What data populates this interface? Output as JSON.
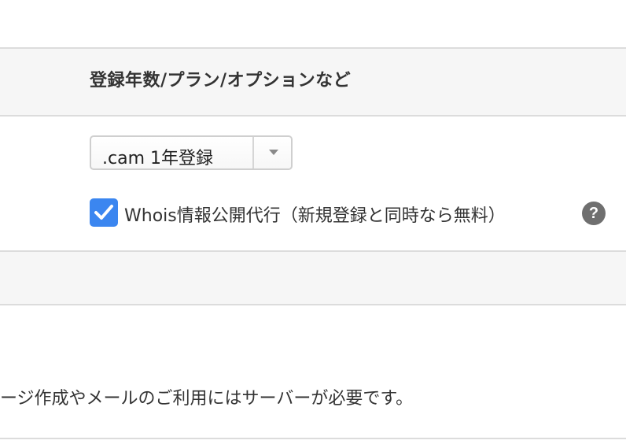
{
  "header": {
    "title": "登録年数/プラン/オプションなど"
  },
  "registration": {
    "period_select": {
      "selected": ".cam 1年登録"
    },
    "whois_option": {
      "checked": true,
      "label": "Whois情報公開代行（新規登録と同時なら無料）",
      "help_icon": "?"
    }
  },
  "notice": {
    "text": "ージ作成やメールのご利用にはサーバーが必要です。"
  },
  "colors": {
    "checkbox": "#3b86f0",
    "band": "#f6f6f6",
    "rule": "#dcdcdc",
    "help_icon": "#6f6f6f"
  },
  "icons": {
    "select_arrow": "caret-down-icon",
    "checkbox": "checkmark-icon",
    "help": "question-circle-icon"
  }
}
